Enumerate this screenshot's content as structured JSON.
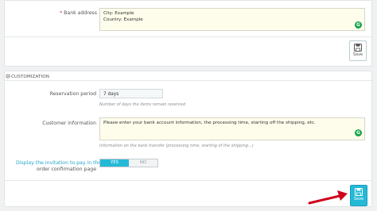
{
  "bank_address": {
    "label": "Bank address",
    "line1": "City: Example",
    "line2": "Country: Example"
  },
  "save_label": "Save",
  "section": {
    "title": "CUSTOMIZATION"
  },
  "reservation": {
    "label": "Reservation period",
    "value": "7 days",
    "help": "Number of days the items remain reserved"
  },
  "customer_info": {
    "label": "Customer information",
    "value": "Please enter your bank account information, the processing time, starting off the shipping, etc.",
    "help": "Information on the bank transfer (processing time, starting of the shipping...)"
  },
  "invitation": {
    "label_line1": "Display the invitation to pay in the",
    "label_line2": "order confirmation page",
    "yes": "YES",
    "no": "NO"
  },
  "colors": {
    "accent": "#25b9d7",
    "grammar": "#15a34a",
    "required": "#e0245e",
    "arrow": "#d0021b"
  },
  "icons": [
    "grammarly-icon",
    "save-icon",
    "cogs-icon",
    "arrow-icon"
  ]
}
